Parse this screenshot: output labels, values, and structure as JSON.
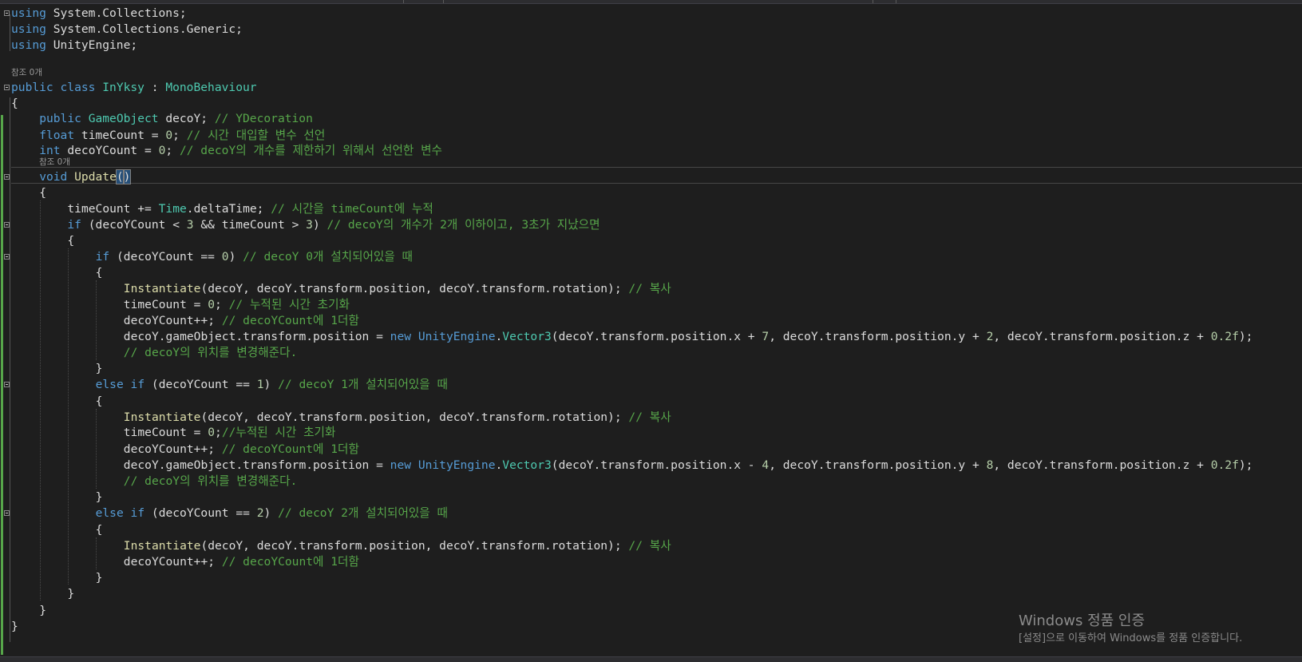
{
  "editor": {
    "lines": [
      {
        "segments": [
          {
            "t": "using",
            "c": "kw"
          },
          {
            "t": " System.Collections;"
          }
        ]
      },
      {
        "segments": [
          {
            "t": "using",
            "c": "kw"
          },
          {
            "t": " System.Collections.Generic;"
          }
        ]
      },
      {
        "segments": [
          {
            "t": "using",
            "c": "kw"
          },
          {
            "t": " UnityEngine;"
          }
        ]
      },
      {
        "segments": [
          {
            "t": "public",
            "c": "kw"
          },
          {
            "t": " "
          },
          {
            "t": "class",
            "c": "kw"
          },
          {
            "t": " "
          },
          {
            "t": "InYksy",
            "c": "type"
          },
          {
            "t": " : "
          },
          {
            "t": "MonoBehaviour",
            "c": "type"
          }
        ]
      },
      {
        "segments": [
          {
            "t": "{"
          }
        ]
      },
      {
        "segments": [
          {
            "t": "public",
            "c": "kw"
          },
          {
            "t": " "
          },
          {
            "t": "GameObject",
            "c": "type"
          },
          {
            "t": " decoY; "
          },
          {
            "t": "// YDecoration",
            "c": "cmt"
          }
        ]
      },
      {
        "segments": [
          {
            "t": "float",
            "c": "kw"
          },
          {
            "t": " timeCount = "
          },
          {
            "t": "0",
            "c": "num"
          },
          {
            "t": "; "
          },
          {
            "t": "// 시간 대입할 변수 선언",
            "c": "cmt"
          }
        ]
      },
      {
        "segments": [
          {
            "t": "int",
            "c": "kw"
          },
          {
            "t": " decoYCount = "
          },
          {
            "t": "0",
            "c": "num"
          },
          {
            "t": "; "
          },
          {
            "t": "// decoY의 개수를 제한하기 위해서 선언한 변수",
            "c": "cmt"
          }
        ]
      },
      {
        "segments": [
          {
            "t": "void",
            "c": "kw"
          },
          {
            "t": " "
          },
          {
            "t": "Update",
            "c": "fn"
          },
          {
            "t": "(",
            "c": "brace-hl"
          },
          {
            "t": ")",
            "c": "brace-hl"
          }
        ]
      },
      {
        "segments": [
          {
            "t": "{"
          }
        ]
      },
      {
        "segments": [
          {
            "t": "timeCount += "
          },
          {
            "t": "Time",
            "c": "type"
          },
          {
            "t": ".deltaTime; "
          },
          {
            "t": "// 시간을 timeCount에 누적",
            "c": "cmt"
          }
        ]
      },
      {
        "segments": [
          {
            "t": "if",
            "c": "kw"
          },
          {
            "t": " (decoYCount < "
          },
          {
            "t": "3",
            "c": "num"
          },
          {
            "t": " && timeCount > "
          },
          {
            "t": "3",
            "c": "num"
          },
          {
            "t": ") "
          },
          {
            "t": "// decoY의 개수가 2개 이하이고, 3초가 지났으면",
            "c": "cmt"
          }
        ]
      },
      {
        "segments": [
          {
            "t": "{"
          }
        ]
      },
      {
        "segments": [
          {
            "t": "if",
            "c": "kw"
          },
          {
            "t": " (decoYCount == "
          },
          {
            "t": "0",
            "c": "num"
          },
          {
            "t": ") "
          },
          {
            "t": "// decoY 0개 설치되어있을 때",
            "c": "cmt"
          }
        ]
      },
      {
        "segments": [
          {
            "t": "{"
          }
        ]
      },
      {
        "segments": [
          {
            "t": "Instantiate",
            "c": "fn"
          },
          {
            "t": "(decoY, decoY.transform.position, decoY.transform.rotation); "
          },
          {
            "t": "// 복사",
            "c": "cmt"
          }
        ]
      },
      {
        "segments": [
          {
            "t": "timeCount = "
          },
          {
            "t": "0",
            "c": "num"
          },
          {
            "t": "; "
          },
          {
            "t": "// 누적된 시간 초기화",
            "c": "cmt"
          }
        ]
      },
      {
        "segments": [
          {
            "t": "decoYCount++; "
          },
          {
            "t": "// decoYCount에 1더함",
            "c": "cmt"
          }
        ]
      },
      {
        "segments": [
          {
            "t": "decoY.gameObject.transform.position = "
          },
          {
            "t": "new",
            "c": "kw"
          },
          {
            "t": " "
          },
          {
            "t": "UnityEngine",
            "c": "kw"
          },
          {
            "t": "."
          },
          {
            "t": "Vector3",
            "c": "type"
          },
          {
            "t": "(decoY.transform.position.x + "
          },
          {
            "t": "7",
            "c": "num"
          },
          {
            "t": ", decoY.transform.position.y + "
          },
          {
            "t": "2",
            "c": "num"
          },
          {
            "t": ", decoY.transform.position.z + "
          },
          {
            "t": "0.2f",
            "c": "num"
          },
          {
            "t": ");"
          }
        ]
      },
      {
        "segments": [
          {
            "t": "// decoY의 위치를 변경해준다.",
            "c": "cmt"
          }
        ]
      },
      {
        "segments": [
          {
            "t": "}"
          }
        ]
      },
      {
        "segments": [
          {
            "t": "else",
            "c": "kw"
          },
          {
            "t": " "
          },
          {
            "t": "if",
            "c": "kw"
          },
          {
            "t": " (decoYCount == "
          },
          {
            "t": "1",
            "c": "num"
          },
          {
            "t": ") "
          },
          {
            "t": "// decoY 1개 설치되어있을 때",
            "c": "cmt"
          }
        ]
      },
      {
        "segments": [
          {
            "t": "{"
          }
        ]
      },
      {
        "segments": [
          {
            "t": "Instantiate",
            "c": "fn"
          },
          {
            "t": "(decoY, decoY.transform.position, decoY.transform.rotation); "
          },
          {
            "t": "// 복사",
            "c": "cmt"
          }
        ]
      },
      {
        "segments": [
          {
            "t": "timeCount = "
          },
          {
            "t": "0",
            "c": "num"
          },
          {
            "t": ";"
          },
          {
            "t": "//누적된 시간 초기화",
            "c": "cmt"
          }
        ]
      },
      {
        "segments": [
          {
            "t": "decoYCount++; "
          },
          {
            "t": "// decoYCount에 1더함",
            "c": "cmt"
          }
        ]
      },
      {
        "segments": [
          {
            "t": "decoY.gameObject.transform.position = "
          },
          {
            "t": "new",
            "c": "kw"
          },
          {
            "t": " "
          },
          {
            "t": "UnityEngine",
            "c": "kw"
          },
          {
            "t": "."
          },
          {
            "t": "Vector3",
            "c": "type"
          },
          {
            "t": "(decoY.transform.position.x - "
          },
          {
            "t": "4",
            "c": "num"
          },
          {
            "t": ", decoY.transform.position.y + "
          },
          {
            "t": "8",
            "c": "num"
          },
          {
            "t": ", decoY.transform.position.z + "
          },
          {
            "t": "0.2f",
            "c": "num"
          },
          {
            "t": ");"
          }
        ]
      },
      {
        "segments": [
          {
            "t": "// decoY의 위치를 변경해준다.",
            "c": "cmt"
          }
        ]
      },
      {
        "segments": [
          {
            "t": "}"
          }
        ]
      },
      {
        "segments": [
          {
            "t": "else",
            "c": "kw"
          },
          {
            "t": " "
          },
          {
            "t": "if",
            "c": "kw"
          },
          {
            "t": " (decoYCount == "
          },
          {
            "t": "2",
            "c": "num"
          },
          {
            "t": ") "
          },
          {
            "t": "// decoY 2개 설치되어있을 때",
            "c": "cmt"
          }
        ]
      },
      {
        "segments": [
          {
            "t": "{"
          }
        ]
      },
      {
        "segments": [
          {
            "t": "Instantiate",
            "c": "fn"
          },
          {
            "t": "(decoY, decoY.transform.position, decoY.transform.rotation); "
          },
          {
            "t": "// 복사",
            "c": "cmt"
          }
        ]
      },
      {
        "segments": [
          {
            "t": "decoYCount++; "
          },
          {
            "t": "// decoYCount에 1더함",
            "c": "cmt"
          }
        ]
      },
      {
        "segments": [
          {
            "t": "}"
          }
        ]
      },
      {
        "segments": [
          {
            "t": "}"
          }
        ]
      },
      {
        "segments": [
          {
            "t": "}"
          }
        ]
      },
      {
        "segments": [
          {
            "t": "}"
          }
        ]
      }
    ],
    "codelens": [
      "참조 0개",
      "참조 0개"
    ]
  },
  "watermark": {
    "title": "Windows 정품 인증",
    "subtitle": "[설정]으로 이동하여 Windows를 정품 인증합니다."
  },
  "colors": {
    "background": "#1e1e1e",
    "keyword": "#569cd6",
    "comment": "#57a64a",
    "type": "#4ec9b0",
    "number": "#b5cea8",
    "method": "#dcdcaa",
    "text": "#dcdcdc"
  }
}
